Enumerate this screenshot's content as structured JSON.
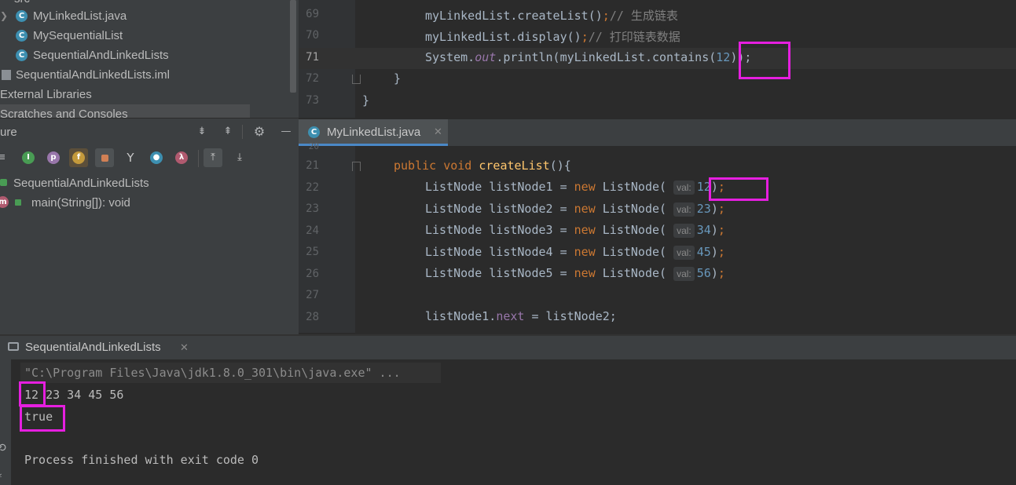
{
  "project_tree": {
    "top_partial": "src",
    "items": [
      {
        "name": "MyLinkedList.java"
      },
      {
        "name": "MySequentialList"
      },
      {
        "name": "SequentialAndLinkedLists"
      },
      {
        "name": "SequentialAndLinkedLists.iml"
      },
      {
        "name": "External Libraries"
      },
      {
        "name": "Scratches and Consoles"
      }
    ]
  },
  "structure": {
    "title": "ure",
    "class_name": "SequentialAndLinkedLists",
    "method": "main(String[]): void"
  },
  "editor_top": {
    "lines": [
      {
        "no": "69",
        "call": "myLinkedList.createList",
        "comment": "// 生成链表"
      },
      {
        "no": "70",
        "call": "myLinkedList.display",
        "comment": "// 打印链表数据"
      },
      {
        "no": "71",
        "prefix": "System.",
        "field": "out",
        "mid": ".println(myLinkedList.contains(",
        "arg": "12",
        "suffix": "));"
      },
      {
        "no": "72",
        "text": "}"
      },
      {
        "no": "73",
        "text": "}"
      }
    ]
  },
  "editor_tab": {
    "label": "MyLinkedList.java"
  },
  "editor_bottom": {
    "lines": [
      {
        "no": "21",
        "kw1": "public",
        "kw2": "void",
        "fn": "createList",
        "rest": "(){"
      },
      {
        "no": "22",
        "var": "listNode1",
        "hint": "val:",
        "val": "12"
      },
      {
        "no": "23",
        "var": "listNode2",
        "hint": "val:",
        "val": "23"
      },
      {
        "no": "24",
        "var": "listNode3",
        "hint": "val:",
        "val": "34"
      },
      {
        "no": "25",
        "var": "listNode4",
        "hint": "val:",
        "val": "45"
      },
      {
        "no": "26",
        "var": "listNode5",
        "hint": "val:",
        "val": "56"
      },
      {
        "no": "27"
      },
      {
        "no": "28",
        "lhs": "listNode1.",
        "field": "next",
        "rhs": " = listNode2;"
      }
    ],
    "type_name": "ListNode",
    "new_kw": "new"
  },
  "run": {
    "tab_label": "SequentialAndLinkedLists",
    "cmd": "\"C:\\Program Files\\Java\\jdk1.8.0_301\\bin\\java.exe\" ...",
    "out_first": "12",
    "out_rest": " 23 34 45 56",
    "out_bool": "true",
    "exit_msg": "Process finished with exit code 0"
  },
  "colors": {
    "highlight": "#e61fe0",
    "accent": "#4a88c7"
  }
}
